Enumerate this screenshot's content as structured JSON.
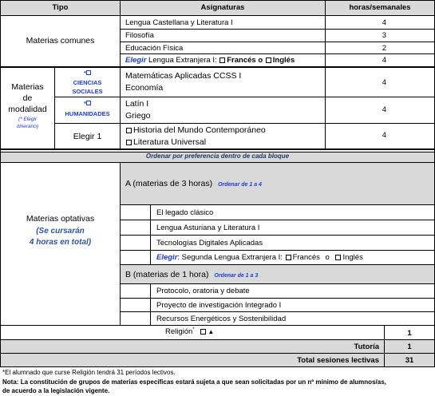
{
  "header": {
    "tipo": "Tipo",
    "asignaturas": "Asignaturas",
    "horas": "horas/semanales"
  },
  "comunes": {
    "label": "Materias comunes",
    "rows": [
      {
        "name": "Lengua Castellana y Literatura I",
        "hours": "4"
      },
      {
        "name": "Filosofía",
        "hours": "3"
      },
      {
        "name": "Educación Física",
        "hours": "2"
      }
    ],
    "lengua_extranjera": {
      "elegir": "Elegir",
      "text": "Lengua Extranjera I:",
      "frances": "Francés",
      "o": "o",
      "ingles": "Inglés",
      "hours": "4"
    }
  },
  "modalidad": {
    "label_line1": "Materias",
    "label_line2": "de",
    "label_line3": "modalidad",
    "note_line1": "(* Elegir",
    "note_line2": "itinerario)",
    "ciencias": {
      "mark": "*",
      "line1": "CIENCIAS",
      "line2": "SOCIALES",
      "subject1": "Matemáticas Aplicadas CCSS I",
      "subject2": "Economía",
      "hours": "4"
    },
    "humanidades": {
      "mark": "*",
      "line1": "HUMANIDADES",
      "subject1": "Latín I",
      "subject2": "Griego",
      "hours": "4"
    },
    "elegir1": {
      "label": "Elegir 1",
      "option1": "Historia del Mundo Contemporáneo",
      "option2": "Literatura Universal",
      "hours": "4"
    }
  },
  "order_note": "Ordenar por preferencia dentro de cada bloque",
  "optativas": {
    "label": "Materias optativas",
    "note_line1": "(Se cursarán",
    "note_line2": "4 horas en total)",
    "blockA": {
      "title": "A (materias de 3 horas)",
      "order": "Ordenar de 1 a 4"
    },
    "blockA_items": [
      "El legado clásico",
      "Lengua Asturiana y Literatura I",
      "Tecnologías Digitales Aplicadas"
    ],
    "blockA_elegir": {
      "elegir": "Elegir",
      "text": ": Segunda Lengua Extranjera I:",
      "frances": "Francés",
      "o": "o",
      "ingles": "Inglés"
    },
    "blockB": {
      "title": "B (materias de 1 hora)",
      "order": "Ordenar de 1 a 3"
    },
    "blockB_items": [
      "Protocolo, oratoria y debate",
      "Proyecto de investigación Integrado I",
      "Recursos Energéticos y Sostenibilidad"
    ]
  },
  "religion": {
    "label": "Religión",
    "mark": "*",
    "hours": "1"
  },
  "tutoria": {
    "label": "Tutoría",
    "hours": "1"
  },
  "total": {
    "label": "Total sesiones lectivas",
    "hours": "31"
  },
  "footnotes": {
    "line1": "*El alumnado que curse Religión tendrá 31 períodos lectivos.",
    "nota_label": "Nota:",
    "line2": "La constitución de grupos de materias específicas estará sujeta a que sean solicitadas por un nº mínimo de alumnos/as,",
    "line3": "de acuerdo a la legislación vigente."
  },
  "colors": {
    "border": "#000000",
    "header_bg": "#d9d9d9",
    "accent_blue": "#1f3bd6",
    "navy": "#1f3864"
  }
}
